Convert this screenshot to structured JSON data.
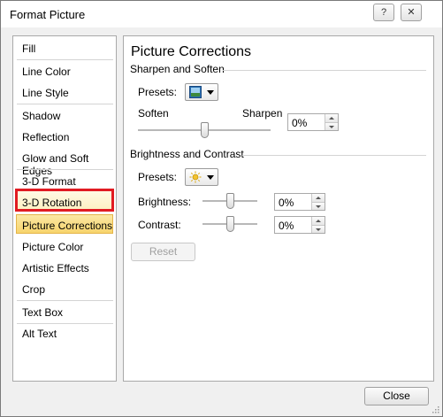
{
  "window": {
    "title": "Format Picture",
    "help_label": "?",
    "close_label": "✕"
  },
  "nav": {
    "items": [
      {
        "label": "Fill"
      },
      {
        "label": "Line Color"
      },
      {
        "label": "Line Style"
      },
      {
        "label": "Shadow"
      },
      {
        "label": "Reflection"
      },
      {
        "label": "Glow and Soft Edges"
      },
      {
        "label": "3-D Format"
      },
      {
        "label": "3-D Rotation"
      },
      {
        "label": "Picture Corrections"
      },
      {
        "label": "Picture Color"
      },
      {
        "label": "Artistic Effects"
      },
      {
        "label": "Crop"
      },
      {
        "label": "Text Box"
      },
      {
        "label": "Alt Text"
      }
    ],
    "selected": "Picture Corrections",
    "highlighted": "3-D Rotation",
    "highlight_color": "#e11b22"
  },
  "panel": {
    "title": "Picture Corrections",
    "sharpen": {
      "heading": "Sharpen and Soften",
      "presets_label": "Presets:",
      "presets_icon": "sharpen-preset-icon",
      "soften_label": "Soften",
      "sharpen_label": "Sharpen",
      "slider_level": 0.5,
      "value": "0%"
    },
    "brightness": {
      "heading": "Brightness and Contrast",
      "presets_label": "Presets:",
      "presets_icon": "sun-icon",
      "brightness_label": "Brightness:",
      "brightness_level": 0.5,
      "brightness_value": "0%",
      "contrast_label": "Contrast:",
      "contrast_level": 0.5,
      "contrast_value": "0%"
    },
    "reset_label": "Reset"
  },
  "footer": {
    "close_label": "Close"
  },
  "colors": {
    "selected_bg": "#f7d46c",
    "highlight_border": "#e11b22"
  }
}
